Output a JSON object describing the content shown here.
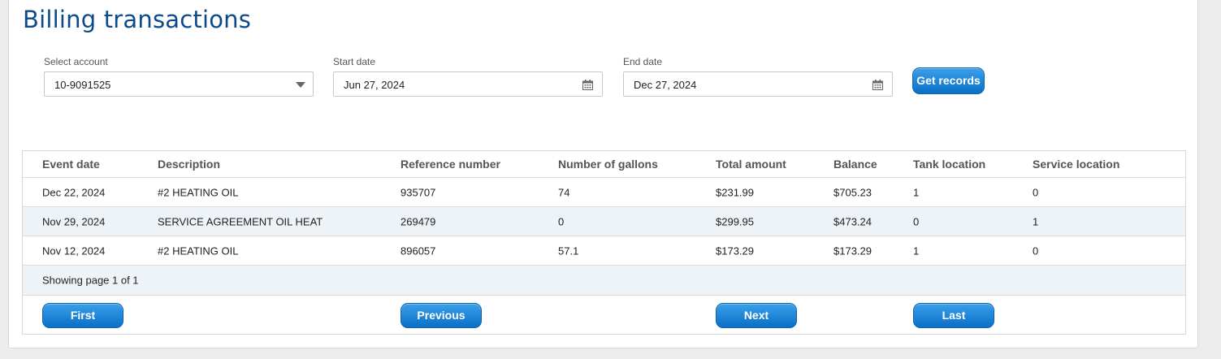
{
  "page": {
    "title": "Billing transactions"
  },
  "filters": {
    "account_label": "Select account",
    "account_value": "10-9091525",
    "start_label": "Start date",
    "start_value": "Jun 27, 2024",
    "end_label": "End date",
    "end_value": "Dec 27, 2024",
    "submit_label": "Get records"
  },
  "table": {
    "columns": [
      "Event date",
      "Description",
      "Reference number",
      "Number of gallons",
      "Total amount",
      "Balance",
      "Tank location",
      "Service location"
    ],
    "rows": [
      [
        "Dec 22, 2024",
        "#2 HEATING OIL",
        "935707",
        "74",
        "$231.99",
        "$705.23",
        "1",
        "0"
      ],
      [
        "Nov 29, 2024",
        "SERVICE AGREEMENT OIL HEAT",
        "269479",
        "0",
        "$299.95",
        "$473.24",
        "0",
        "1"
      ],
      [
        "Nov 12, 2024",
        "#2 HEATING OIL",
        "896057",
        "57.1",
        "$173.29",
        "$173.29",
        "1",
        "0"
      ]
    ],
    "page_info": "Showing page 1 of 1"
  },
  "pager": {
    "first": "First",
    "previous": "Previous",
    "next": "Next",
    "last": "Last"
  },
  "colors": {
    "title": "#0b4a8b",
    "button": "#0a6fc6",
    "alt_row": "#eef3f8"
  },
  "icons": {
    "account_dropdown": "chevron-down-icon",
    "date_picker": "calendar-icon"
  }
}
